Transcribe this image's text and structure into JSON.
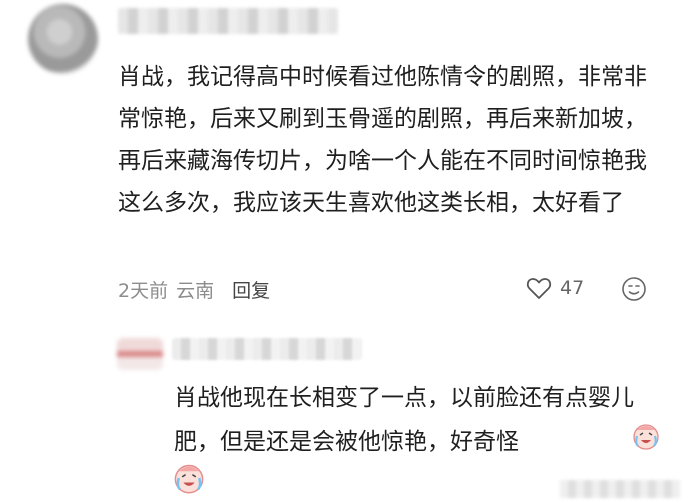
{
  "comment": {
    "text": "肖战，我记得高中时候看过他陈情令的剧照，非常非常惊艳，后来又刷到玉骨遥的剧照，再后来新加坡，再后来藏海传切片，为啥一个人能在不同时间惊艳我这么多次，我应该天生喜欢他这类长相，太好看了",
    "time": "2天前",
    "location": "云南",
    "reply_label": "回复",
    "likes": "47",
    "like_icon": "heart-outline-icon",
    "emoji_icon": "smiley-icon"
  },
  "reply": {
    "text": "肖战他现在长相变了一点，以前脸还有点婴儿肥，但是还是会被他惊艳，好奇怪",
    "sticker_icon": "crying-laugh-sticker"
  },
  "colors": {
    "text": "#1f1f1f",
    "meta": "#8c8c8c",
    "sticker": "#f4a7a7"
  }
}
